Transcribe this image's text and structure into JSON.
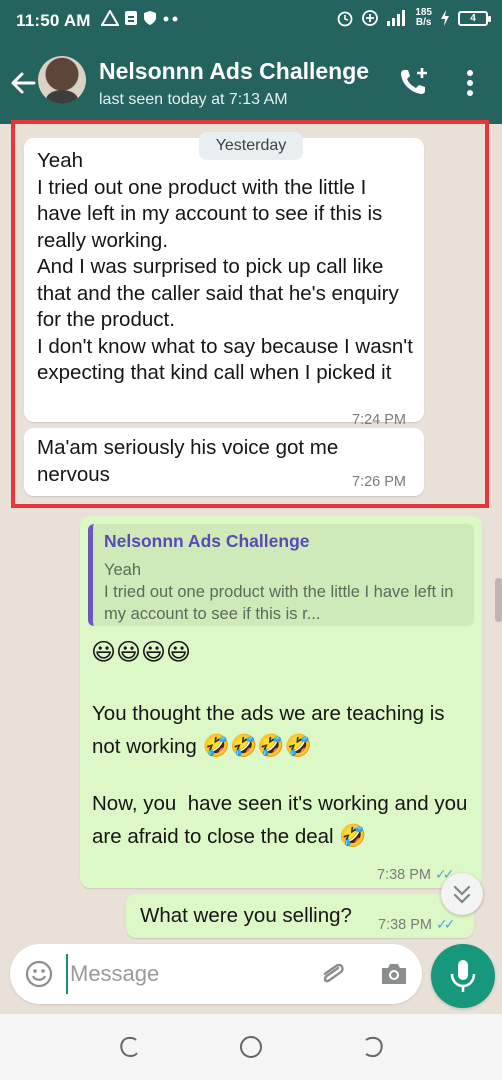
{
  "status_bar": {
    "time": "11:50 AM",
    "net_speed_value": "185",
    "net_speed_unit": "B/s",
    "battery_level": "4",
    "icons": [
      "warning-icon",
      "sim-icon",
      "shield-icon",
      "more-dots-icon",
      "alarm-icon",
      "data-saver-icon",
      "signal-icon",
      "charging-icon",
      "battery-icon"
    ]
  },
  "header": {
    "title": "Nelsonnn Ads Challenge",
    "subtitle": "last seen today at 7:13 AM",
    "color": "#24635e"
  },
  "chat": {
    "date_chip": "Yesterday",
    "messages": [
      {
        "direction": "incoming",
        "text": "Yeah\nI tried out one product with the little I have left in my account to see if this is really working.\nAnd I was surprised to pick up call like that and the caller said that he's enquiry for the product.\nI don't know what to say because I wasn't expecting that kind call when I picked it",
        "time": "7:24 PM"
      },
      {
        "direction": "incoming",
        "text": "Ma'am seriously his voice got me nervous",
        "time": "7:26 PM"
      },
      {
        "direction": "outgoing",
        "quote": {
          "author": "Nelsonnn Ads Challenge",
          "text": "Yeah\nI tried out one product with the little I have left in my account to see if this is r..."
        },
        "emoji_line": "😃😃😃😃",
        "paragraph_1": "You thought the ads we are teaching is not working",
        "paragraph_1_emoji": "🤣🤣🤣🤣",
        "paragraph_2": "Now, you  have seen it's working and you are afraid to close the deal",
        "paragraph_2_emoji": "🤣",
        "time": "7:38 PM"
      },
      {
        "direction": "outgoing",
        "text": "What were you selling?",
        "time": "7:38 PM"
      }
    ],
    "incoming_bubble_color": "#ffffff",
    "outgoing_bubble_color": "#dcf8c6",
    "highlight_color": "#e6363b"
  },
  "input": {
    "placeholder": "Message"
  },
  "accent": "#17977b"
}
